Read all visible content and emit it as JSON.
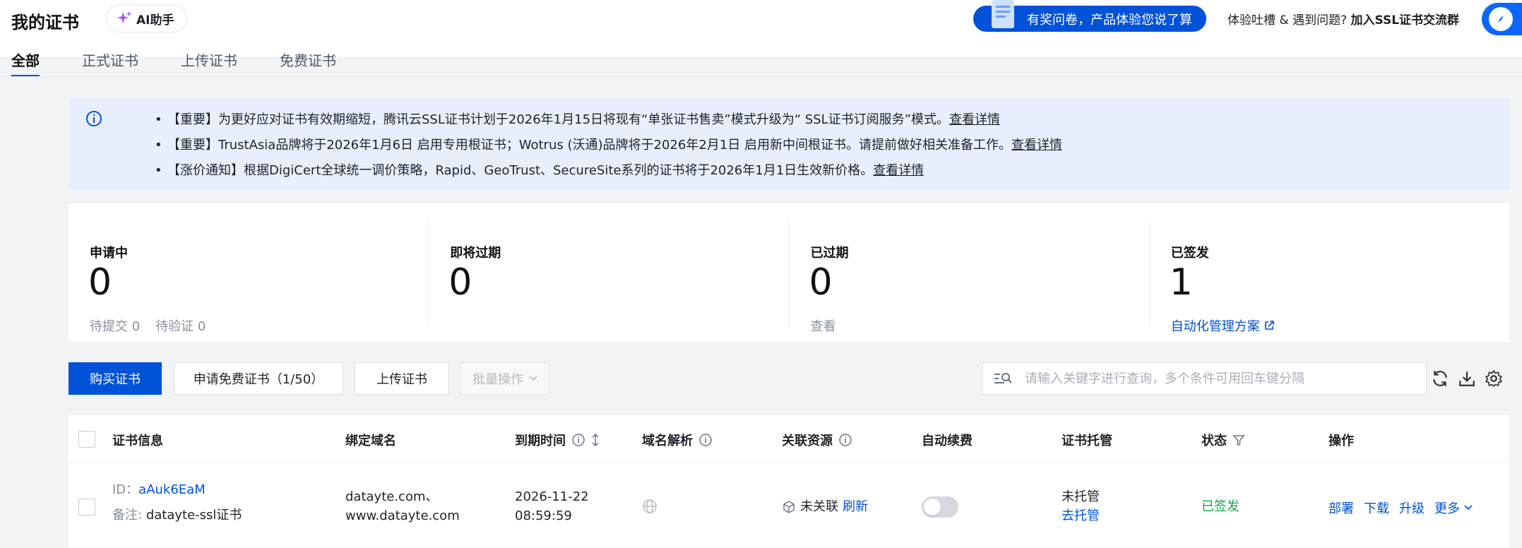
{
  "header": {
    "title": "我的证书",
    "ai_button": "AI助手",
    "survey": "有奖问卷，产品体验您说了算",
    "feedback_prefix": "体验吐槽 & 遇到问题?",
    "feedback_link": "加入SSL证书交流群"
  },
  "tabs": [
    {
      "label": "全部",
      "active": true
    },
    {
      "label": "正式证书"
    },
    {
      "label": "上传证书"
    },
    {
      "label": "免费证书"
    }
  ],
  "notices": [
    {
      "text": "【重要】为更好应对证书有效期缩短，腾讯云SSL证书计划于2026年1月15日将现有“单张证书售卖”模式升级为“ SSL证书订阅服务”模式。",
      "link": "查看详情"
    },
    {
      "text": "【重要】TrustAsia品牌将于2026年1月6日 启用专用根证书；Wotrus (沃通)品牌将于2026年2月1日 启用新中间根证书。请提前做好相关准备工作。",
      "link": "查看详情"
    },
    {
      "text": "【涨价通知】根据DigiCert全球统一调价策略，Rapid、GeoTrust、SecureSite系列的证书将于2026年1月1日生效新价格。",
      "link": "查看详情"
    }
  ],
  "stats": {
    "applying": {
      "label": "申请中",
      "value": "0",
      "sub1": "待提交 0",
      "sub2": "待验证 0"
    },
    "expiring": {
      "label": "即将过期",
      "value": "0"
    },
    "expired": {
      "label": "已过期",
      "value": "0",
      "sub": "查看"
    },
    "issued": {
      "label": "已签发",
      "value": "1",
      "link": "自动化管理方案"
    }
  },
  "toolbar": {
    "buy": "购买证书",
    "apply_free": "申请免费证书（1/50）",
    "upload": "上传证书",
    "batch": "批量操作",
    "search_placeholder": "请输入关键字进行查询，多个条件可用回车键分隔"
  },
  "table": {
    "headers": {
      "info": "证书信息",
      "domain": "绑定域名",
      "expire": "到期时间",
      "dns": "域名解析",
      "resource": "关联资源",
      "renew": "自动续费",
      "hosting": "证书托管",
      "status": "状态",
      "ops": "操作"
    },
    "rows": [
      {
        "id_label": "ID：",
        "id": "aAuk6EaM",
        "remark_label": "备注:",
        "remark": "datayte-ssl证书",
        "domain1": "datayte.com、",
        "domain2": "www.datayte.com",
        "date": "2026-11-22",
        "time": "08:59:59",
        "resource": "未关联",
        "refresh": "刷新",
        "auto_renew": false,
        "hosting": "未托管",
        "hosting_link": "去托管",
        "status": "已签发",
        "ops": [
          "部署",
          "下载",
          "升级",
          "更多"
        ]
      }
    ]
  }
}
